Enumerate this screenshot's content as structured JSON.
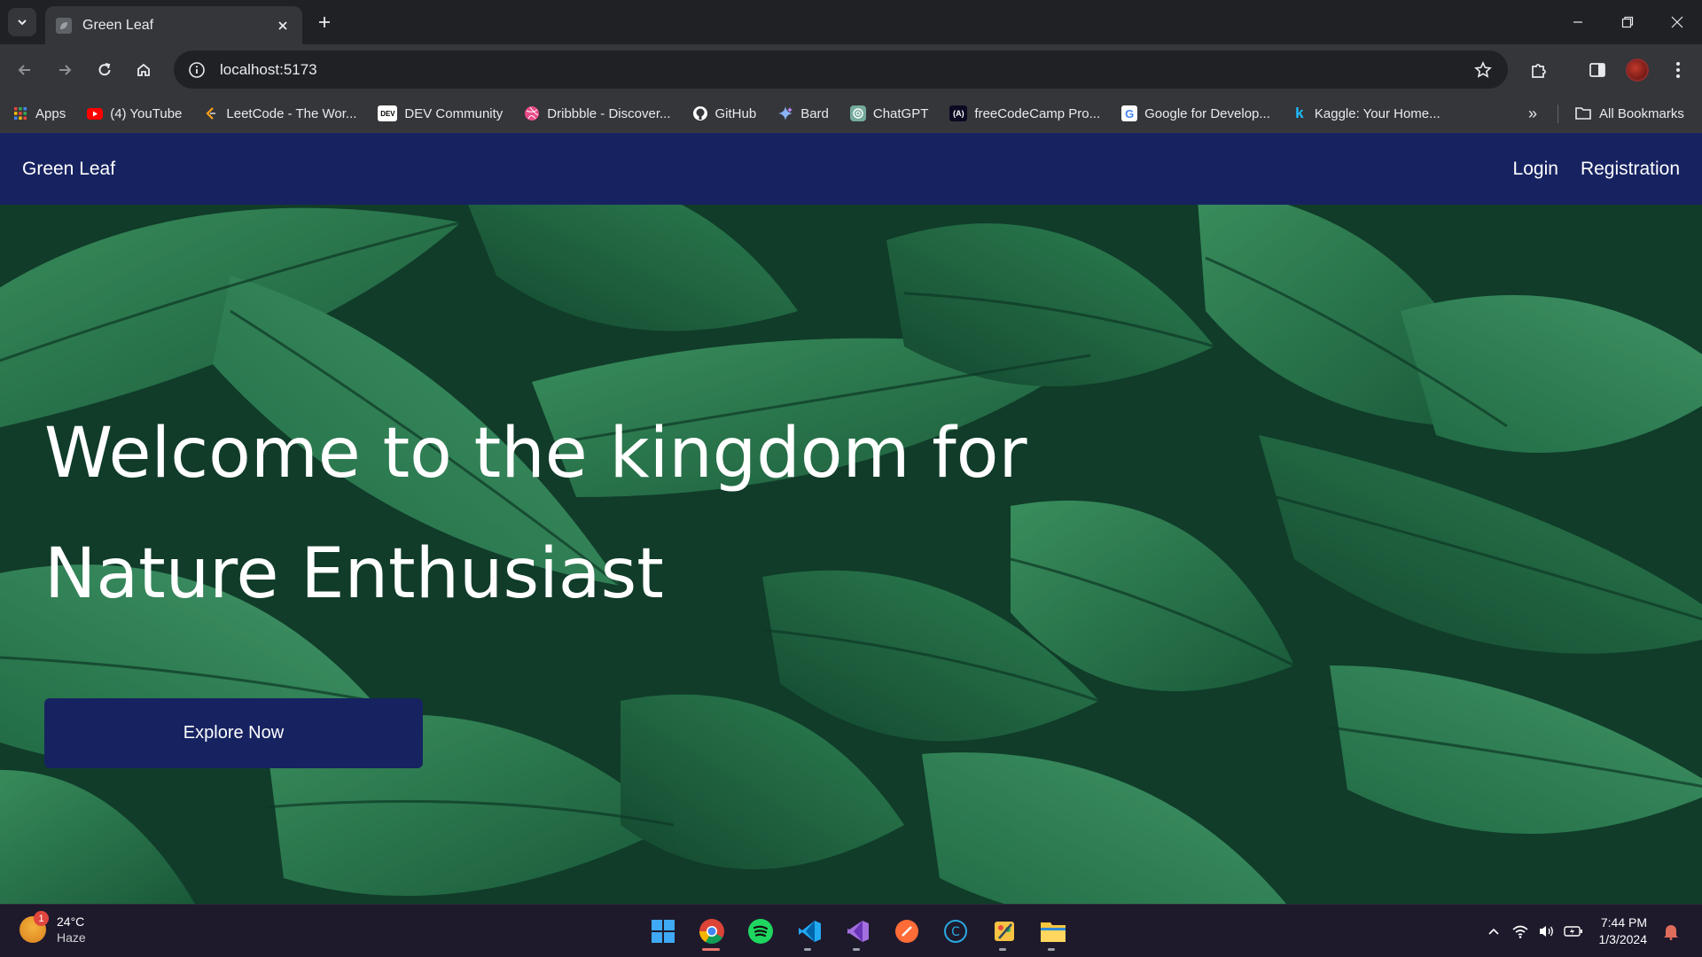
{
  "browser": {
    "tab_title": "Green Leaf",
    "url": "localhost:5173",
    "bookmarks": [
      {
        "label": "Apps",
        "icon": "apps-grid-icon",
        "color": "#e8453c"
      },
      {
        "label": "(4) YouTube",
        "icon": "youtube-icon",
        "color": "#ff0000"
      },
      {
        "label": "LeetCode - The Wor...",
        "icon": "leetcode-icon",
        "color": "#ffa116"
      },
      {
        "label": "DEV Community",
        "icon": "dev-icon",
        "color": "#ffffff"
      },
      {
        "label": "Dribbble - Discover...",
        "icon": "dribbble-icon",
        "color": "#ea4c89"
      },
      {
        "label": "GitHub",
        "icon": "github-icon",
        "color": "#ffffff"
      },
      {
        "label": "Bard",
        "icon": "bard-icon",
        "color": "#8ab4f8"
      },
      {
        "label": "ChatGPT",
        "icon": "chatgpt-icon",
        "color": "#74aa9c"
      },
      {
        "label": "freeCodeCamp Pro...",
        "icon": "freecodecamp-icon",
        "color": "#ffffff"
      },
      {
        "label": "Google for Develop...",
        "icon": "google-icon",
        "color": "#4285f4"
      },
      {
        "label": "Kaggle: Your Home...",
        "icon": "kaggle-icon",
        "color": "#20beff"
      }
    ],
    "all_bookmarks": "All Bookmarks"
  },
  "site": {
    "brand": "Green Leaf",
    "nav": {
      "login": "Login",
      "registration": "Registration"
    },
    "hero": {
      "title_line1": "Welcome to the kingdom for",
      "title_line2": "Nature Enthusiast",
      "cta": "Explore Now"
    },
    "colors": {
      "nav_bg": "#172361",
      "hero_green": "#1a5a39"
    }
  },
  "taskbar": {
    "weather": {
      "temp": "24°C",
      "condition": "Haze",
      "badge": "1"
    },
    "apps": [
      "windows-start-icon",
      "chrome-icon",
      "spotify-icon",
      "vscode-icon",
      "visual-studio-icon",
      "postman-icon",
      "c-app-icon",
      "paint-icon",
      "file-explorer-icon"
    ],
    "time": "7:44 PM",
    "date": "1/3/2024"
  }
}
